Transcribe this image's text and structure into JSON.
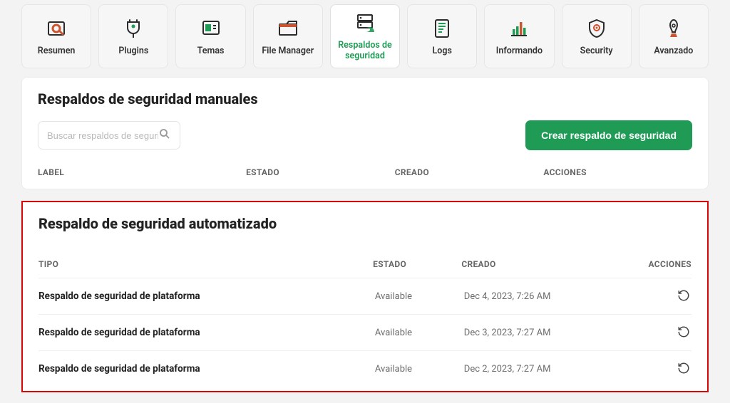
{
  "tabs": [
    {
      "label": "Resumen",
      "icon": "overview"
    },
    {
      "label": "Plugins",
      "icon": "plugin"
    },
    {
      "label": "Temas",
      "icon": "themes"
    },
    {
      "label": "File Manager",
      "icon": "folder"
    },
    {
      "label": "Respaldos de seguridad",
      "icon": "backups",
      "active": true
    },
    {
      "label": "Logs",
      "icon": "logs"
    },
    {
      "label": "Informando",
      "icon": "reporting"
    },
    {
      "label": "Security",
      "icon": "security"
    },
    {
      "label": "Avanzado",
      "icon": "advanced"
    }
  ],
  "manual": {
    "title": "Respaldos de seguridad manuales",
    "search_placeholder": "Buscar respaldos de seguridad",
    "create_label": "Crear respaldo de seguridad",
    "cols": {
      "label": "LABEL",
      "estado": "ESTADO",
      "creado": "CREADO",
      "acciones": "ACCIONES"
    }
  },
  "auto": {
    "title": "Respaldo de seguridad automatizado",
    "cols": {
      "tipo": "TIPO",
      "estado": "ESTADO",
      "creado": "CREADO",
      "acciones": "ACCIONES"
    },
    "rows": [
      {
        "tipo": "Respaldo de seguridad de plataforma",
        "estado": "Available",
        "creado": "Dec 4, 2023, 7:26 AM"
      },
      {
        "tipo": "Respaldo de seguridad de plataforma",
        "estado": "Available",
        "creado": "Dec 3, 2023, 7:27 AM"
      },
      {
        "tipo": "Respaldo de seguridad de plataforma",
        "estado": "Available",
        "creado": "Dec 2, 2023, 7:27 AM"
      }
    ]
  }
}
